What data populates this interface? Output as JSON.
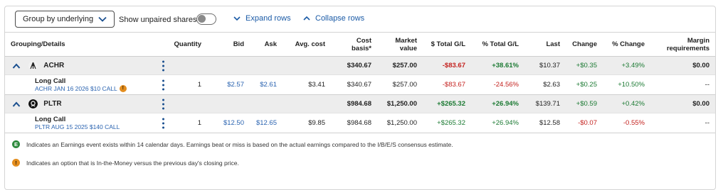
{
  "toolbar": {
    "group_select_value": "Group by underlying",
    "unpaired_label": "Show unpaired shares",
    "unpaired_on": false,
    "expand_label": "Expand rows",
    "collapse_label": "Collapse rows"
  },
  "columns": {
    "grouping": "Grouping/Details",
    "quantity": "Quantity",
    "bid": "Bid",
    "ask": "Ask",
    "avg_cost": "Avg. cost",
    "cost_basis": [
      "Cost",
      "basis*"
    ],
    "market_value": [
      "Market",
      "value"
    ],
    "total_gl_dollar": "$ Total G/L",
    "total_gl_pct": "% Total G/L",
    "last": "Last",
    "change": "Change",
    "pct_change": "% Change",
    "margin": [
      "Margin",
      "requirements"
    ]
  },
  "groups": [
    {
      "symbol": "ACHR",
      "icon": "archer-logo-icon",
      "cost_basis": "$340.67",
      "market_value": "$257.00",
      "total_gl_dollar": "-$83.67",
      "total_gl_pct": "+38.61%",
      "last": "$10.37",
      "change": "+$0.35",
      "pct_change": "+3.49%",
      "margin": "$0.00",
      "detail": {
        "type": "Long Call",
        "description": "ACHR JAN 16 2026 $10 CALL",
        "badge": "!",
        "quantity": "1",
        "bid": "$2.57",
        "ask": "$2.61",
        "avg_cost": "$3.41",
        "cost_basis": "$340.67",
        "market_value": "$257.00",
        "total_gl_dollar": "-$83.67",
        "total_gl_pct": "-24.56%",
        "last": "$2.63",
        "change": "+$0.25",
        "pct_change": "+10.50%",
        "margin": "--"
      }
    },
    {
      "symbol": "PLTR",
      "icon": "palantir-logo-icon",
      "cost_basis": "$984.68",
      "market_value": "$1,250.00",
      "total_gl_dollar": "+$265.32",
      "total_gl_pct": "+26.94%",
      "last": "$139.71",
      "change": "+$0.59",
      "pct_change": "+0.42%",
      "margin": "$0.00",
      "detail": {
        "type": "Long Call",
        "description": "PLTR AUG 15 2025 $140 CALL",
        "badge": "",
        "quantity": "1",
        "bid": "$12.50",
        "ask": "$12.65",
        "avg_cost": "$9.85",
        "cost_basis": "$984.68",
        "market_value": "$1,250.00",
        "total_gl_dollar": "+$265.32",
        "total_gl_pct": "+26.94%",
        "last": "$12.58",
        "change": "-$0.07",
        "pct_change": "-0.55%",
        "margin": "--"
      }
    }
  ],
  "legend": [
    {
      "badge": "E",
      "text": "Indicates an Earnings event exists within 14 calendar days. Earnings beat or miss is based on the actual earnings compared to the I/B/E/S consensus estimate."
    },
    {
      "badge": "!",
      "text": "Indicates an option that is In-the-Money versus the previous day's closing price."
    }
  ],
  "colors": {
    "link_blue": "#1a5aa6",
    "gain_green": "#1c7a33",
    "loss_red": "#c4221f",
    "group_row_bg": "#ededed",
    "itm_badge": "#e38d1e",
    "earnings_badge": "#2f8a3e"
  }
}
